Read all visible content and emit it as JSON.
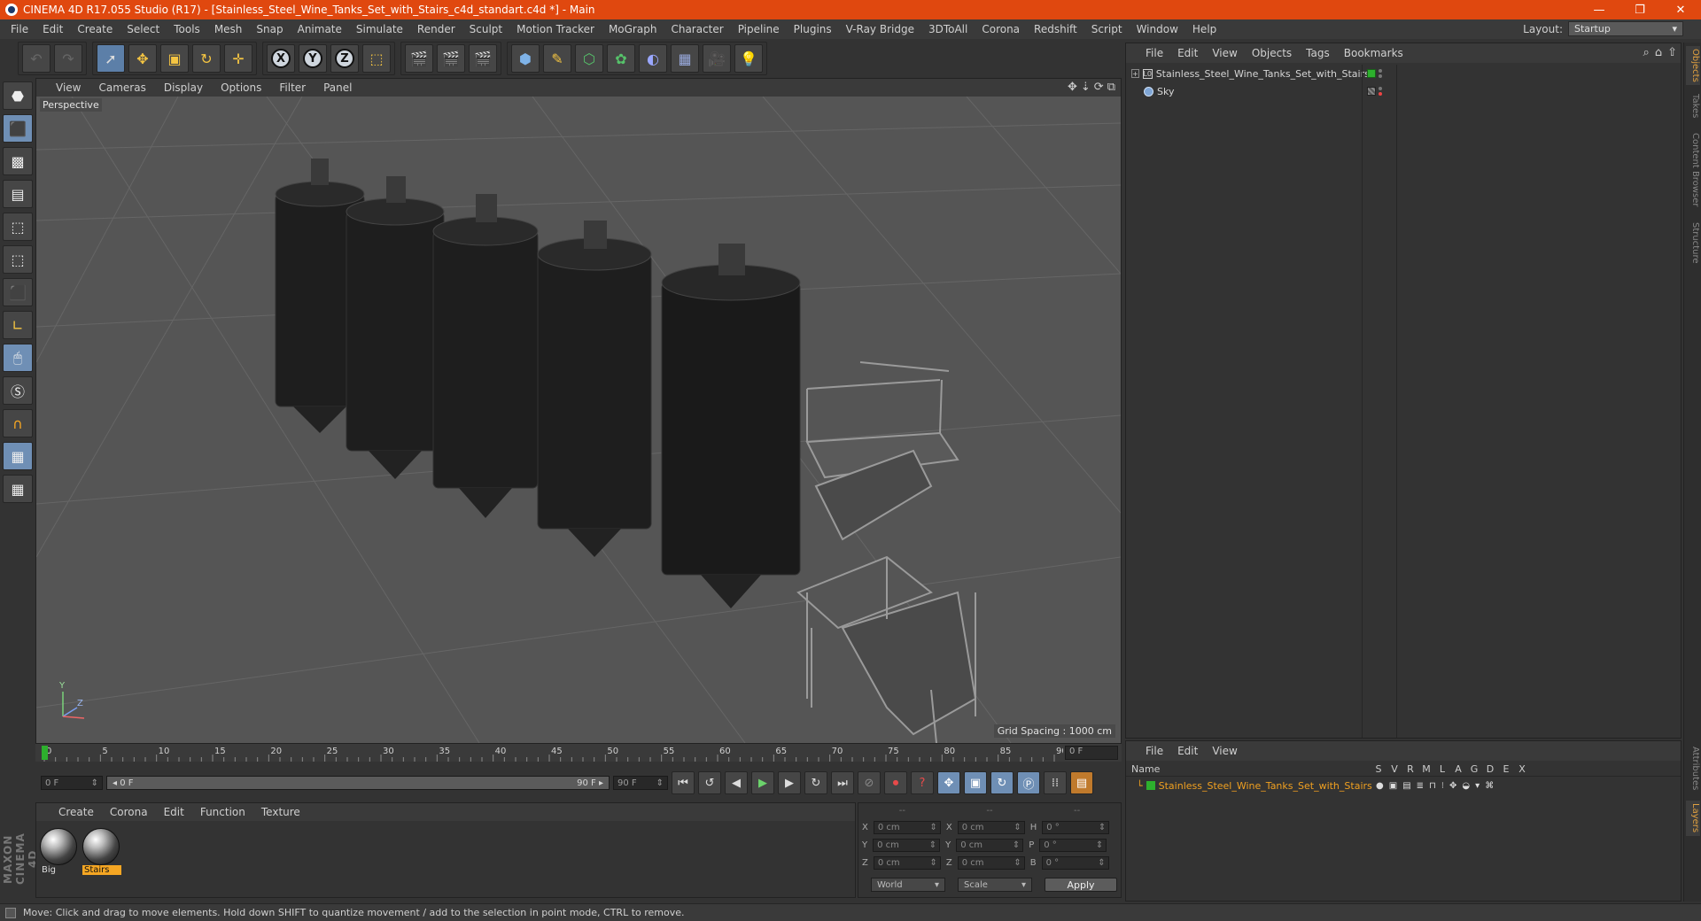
{
  "window": {
    "title": "CINEMA 4D R17.055 Studio (R17) - [Stainless_Steel_Wine_Tanks_Set_with_Stairs_c4d_standart.c4d *] - Main",
    "controls": {
      "minimize": "—",
      "restore": "❐",
      "close": "✕"
    }
  },
  "menubar": {
    "items": [
      "File",
      "Edit",
      "Create",
      "Select",
      "Tools",
      "Mesh",
      "Snap",
      "Animate",
      "Simulate",
      "Render",
      "Sculpt",
      "Motion Tracker",
      "MoGraph",
      "Character",
      "Pipeline",
      "Plugins",
      "V-Ray Bridge",
      "3DToAll",
      "Corona",
      "Redshift",
      "Script",
      "Window",
      "Help"
    ],
    "layout_label": "Layout:",
    "layout_value": "Startup"
  },
  "viewport": {
    "menu": [
      "View",
      "Cameras",
      "Display",
      "Options",
      "Filter",
      "Panel"
    ],
    "label": "Perspective",
    "grid_spacing": "Grid Spacing : 1000 cm",
    "axis_y": "Y",
    "axis_z": "Z"
  },
  "timeline": {
    "ticks": [
      "0",
      "5",
      "10",
      "15",
      "20",
      "25",
      "30",
      "35",
      "40",
      "45",
      "50",
      "55",
      "60",
      "65",
      "70",
      "75",
      "80",
      "85",
      "90"
    ],
    "current_frame_field": "0 F"
  },
  "transport": {
    "start_field": "0 F",
    "range_start": "◂ 0 F",
    "range_end": "90 F ▸",
    "end_field": "90 F"
  },
  "materials": {
    "menu": [
      "Create",
      "Corona",
      "Edit",
      "Function",
      "Texture"
    ],
    "items": [
      {
        "name": "Big",
        "selected": false
      },
      {
        "name": "Stairs",
        "selected": true
      }
    ]
  },
  "coordinates": {
    "head": [
      "--",
      "--",
      "--"
    ],
    "rows": [
      {
        "a_label": "X",
        "a_value": "0 cm",
        "b_label": "X",
        "b_value": "0 cm",
        "c_label": "H",
        "c_value": "0 °"
      },
      {
        "a_label": "Y",
        "a_value": "0 cm",
        "b_label": "Y",
        "b_value": "0 cm",
        "c_label": "P",
        "c_value": "0 °"
      },
      {
        "a_label": "Z",
        "a_value": "0 cm",
        "b_label": "Z",
        "b_value": "0 cm",
        "c_label": "B",
        "c_value": "0 °"
      }
    ],
    "mode_world": "World",
    "mode_scale": "Scale",
    "apply": "Apply"
  },
  "objects": {
    "menu": [
      "File",
      "Edit",
      "View",
      "Objects",
      "Tags",
      "Bookmarks"
    ],
    "items": [
      {
        "name": "Stainless_Steel_Wine_Tanks_Set_with_Stairs",
        "icon": "null-icon",
        "visible_color": "#2db02d"
      },
      {
        "name": "Sky",
        "icon": "sky-icon"
      }
    ]
  },
  "layers": {
    "menu": [
      "File",
      "Edit",
      "View"
    ],
    "header_name": "Name",
    "header_cols": [
      "S",
      "V",
      "R",
      "M",
      "L",
      "A",
      "G",
      "D",
      "E",
      "X"
    ],
    "row_name": "Stainless_Steel_Wine_Tanks_Set_with_Stairs"
  },
  "right_tabs": [
    "Objects",
    "Takes",
    "Content Browser",
    "Structure",
    "Attributes",
    "Layers"
  ],
  "status": {
    "text": "Move: Click and drag to move elements. Hold down SHIFT to quantize movement / add to the selection in point mode, CTRL to remove."
  },
  "brand": {
    "logo_text": "MAXON CINEMA 4D"
  },
  "colors": {
    "title_bar": "#e0480f",
    "accent_selected": "#f5a623",
    "active_tool": "#5c7fa8"
  }
}
